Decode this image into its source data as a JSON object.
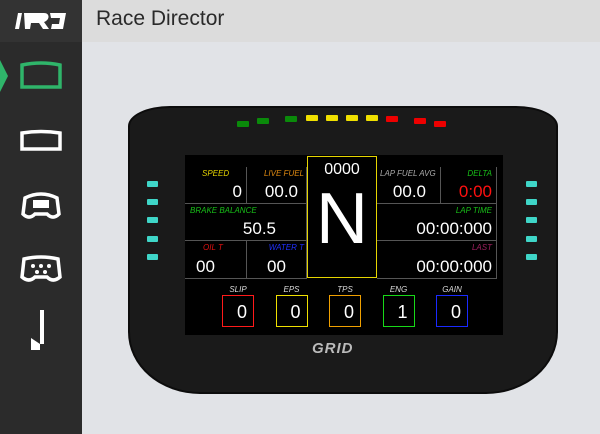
{
  "app": {
    "title": "Race Director",
    "logo_text": "RD"
  },
  "sidebar": {
    "items": [
      {
        "name": "dashboard-wide",
        "active": true
      },
      {
        "name": "dashboard-narrow"
      },
      {
        "name": "wheel-round"
      },
      {
        "name": "wheel-formula"
      },
      {
        "name": "pedal"
      }
    ]
  },
  "colors": {
    "accent": "#2fb56a",
    "led_green": "#0a8a0a",
    "led_yellow": "#f0e000",
    "led_red": "#ee0000",
    "side_led": "#3fd6c8"
  },
  "leds": [
    "#0a8a0a",
    "#0a8a0a",
    "#0a8a0a",
    "#f0e000",
    "#f0e000",
    "#f0e000",
    "#f0e000",
    "#ee0000",
    "#ee0000",
    "#ee0000"
  ],
  "dash": {
    "rpm": "0000",
    "gear": "N",
    "speed": {
      "label": "SPEED",
      "value": "0"
    },
    "live_fuel": {
      "label": "LIVE FUEL",
      "value": "00.0"
    },
    "lap_fuel_avg": {
      "label": "LAP FUEL AVG",
      "value": "00.0"
    },
    "delta": {
      "label": "DELTA",
      "value": "0:00"
    },
    "brake_balance": {
      "label": "BRAKE BALANCE",
      "value": "50.5"
    },
    "lap_time": {
      "label": "LAP TIME",
      "value": "00:00:000"
    },
    "oil_t": {
      "label": "OIL T",
      "value": "00"
    },
    "water_t": {
      "label": "WATER T",
      "value": "00"
    },
    "last": {
      "label": "LAST",
      "value": "00:00:000"
    },
    "boxes": [
      {
        "label": "SLIP",
        "value": "0",
        "color": "#ff1a1a"
      },
      {
        "label": "EPS",
        "value": "0",
        "color": "#f0e000"
      },
      {
        "label": "TPS",
        "value": "0",
        "color": "#f0a000"
      },
      {
        "label": "ENG",
        "value": "1",
        "color": "#18d818"
      },
      {
        "label": "GAIN",
        "value": "0",
        "color": "#1a2aff"
      }
    ]
  },
  "brand": "GRID"
}
